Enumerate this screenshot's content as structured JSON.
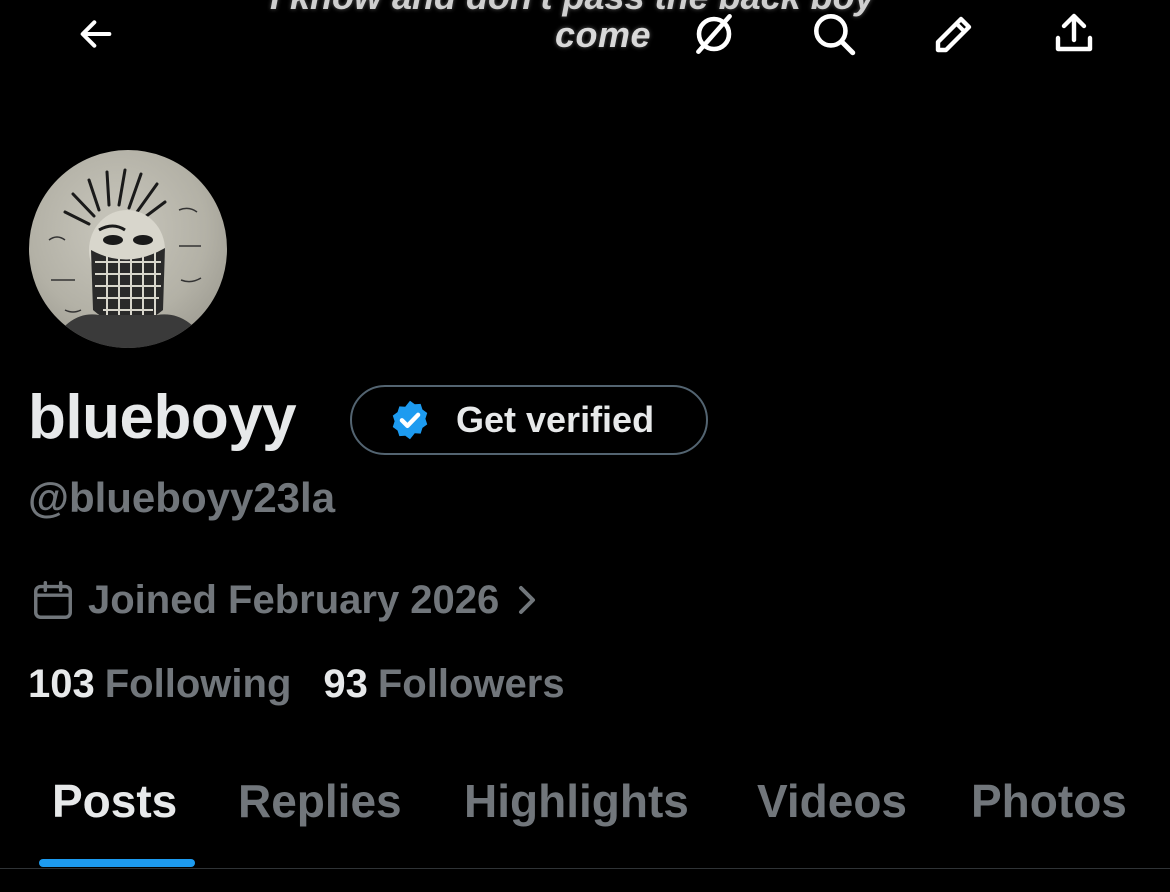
{
  "topbar": {
    "banner_text": "come",
    "banner_text_cut": "I know and don't pass the back boy"
  },
  "profile": {
    "display_name": "blueboyy",
    "handle": "@blueboyy23la",
    "get_verified_label": "Get verified",
    "joined": "Joined February 2026"
  },
  "stats": {
    "following_count": "103",
    "following_label": "Following",
    "followers_count": "93",
    "followers_label": "Followers"
  },
  "tabs": [
    {
      "label": "Posts",
      "active": true
    },
    {
      "label": "Replies",
      "active": false
    },
    {
      "label": "Highlights",
      "active": false
    },
    {
      "label": "Videos",
      "active": false
    },
    {
      "label": "Photos",
      "active": false
    }
  ],
  "colors": {
    "background": "#000000",
    "primary_text": "#e7e9ea",
    "secondary_text": "#71767b",
    "accent": "#1d9bf0",
    "border": "#536471"
  },
  "icons": {
    "back": "arrow-left-icon",
    "grok": "grok-icon",
    "search": "search-icon",
    "edit": "pencil-icon",
    "share": "share-icon",
    "verified": "verified-badge-icon",
    "calendar": "calendar-icon",
    "chevron": "chevron-right-icon"
  }
}
